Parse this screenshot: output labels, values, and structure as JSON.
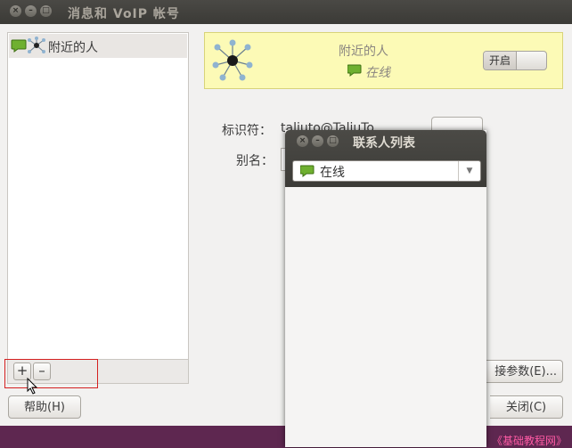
{
  "window": {
    "title": "消息和 VoIP 帐号",
    "buttons": [
      "×",
      "–",
      "□"
    ]
  },
  "accounts": {
    "items": [
      {
        "label": "附近的人"
      }
    ],
    "add_label": "+",
    "remove_label": "–"
  },
  "status": {
    "name": "附近的人",
    "presence": "在线",
    "toggle_label": "开启"
  },
  "form": {
    "identifier_label": "标识符：",
    "identifier_value": "taliuto@TaliuTo",
    "alias_label": "别名："
  },
  "buttons": {
    "help": "帮助(H)",
    "connection_params": "接参数(E)...",
    "close": "关闭(C)"
  },
  "contacts_popup": {
    "title": "联系人列表",
    "status_option": "在线",
    "buttons": [
      "×",
      "–",
      "□"
    ]
  },
  "watermark": "《基础教程网》",
  "colors": {
    "status_bg": "#fcfab6",
    "title_bar": "#3c3b37",
    "desktop": "#5e2750",
    "online_green": "#6fb030"
  }
}
